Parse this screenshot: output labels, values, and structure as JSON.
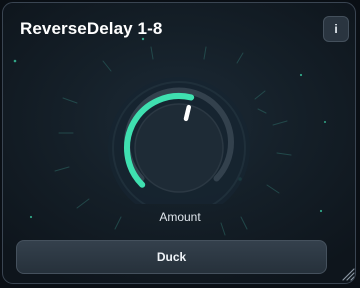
{
  "plugin": {
    "title": "ReverseDelay 1-8"
  },
  "info_button": {
    "label": "i"
  },
  "knob": {
    "label": "Amount",
    "value_fraction": 0.55
  },
  "duck_button": {
    "label": "Duck"
  },
  "colors": {
    "accent": "#3fe0b0",
    "panel": "#152029",
    "track": "#33414d"
  },
  "icons": {
    "resize": "resize-grip-icon"
  }
}
